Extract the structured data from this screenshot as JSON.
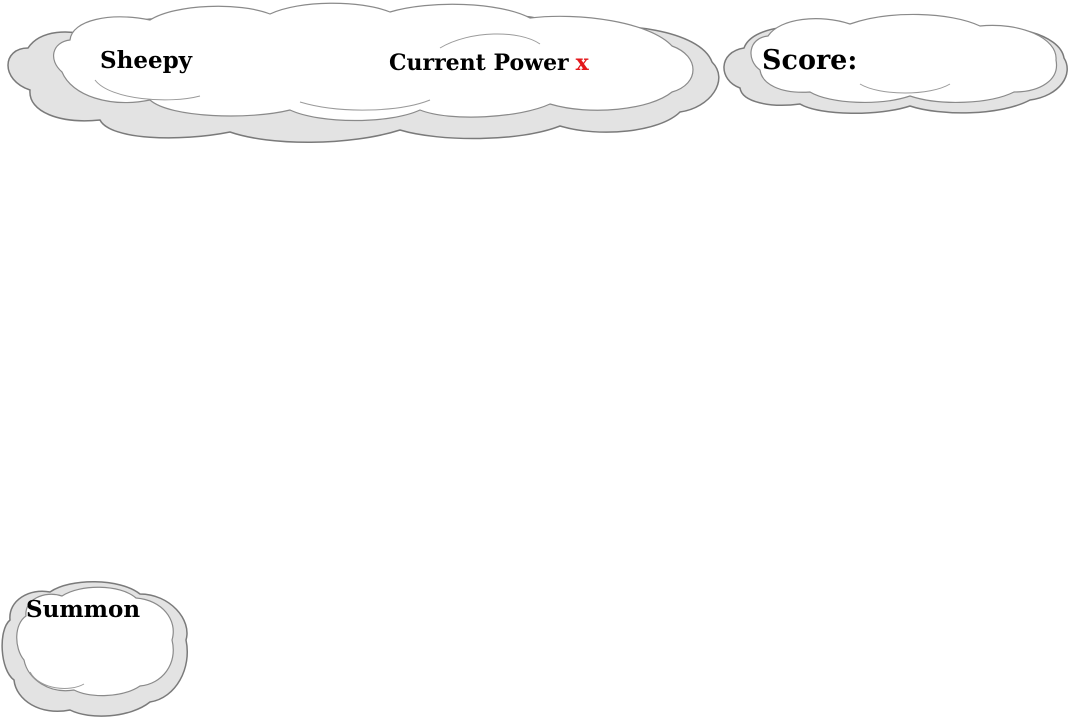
{
  "hud": {
    "player_name": "Sheepy",
    "power_label": "Current Power",
    "power_value": "x",
    "score_label": "Score:"
  },
  "actions": {
    "summon_label": "Summon"
  },
  "colors": {
    "power_value": "#e3171b",
    "cloud_fill": "#ffffff",
    "cloud_shadow": "#e3e3e3",
    "cloud_outline": "#7a7a7a"
  }
}
